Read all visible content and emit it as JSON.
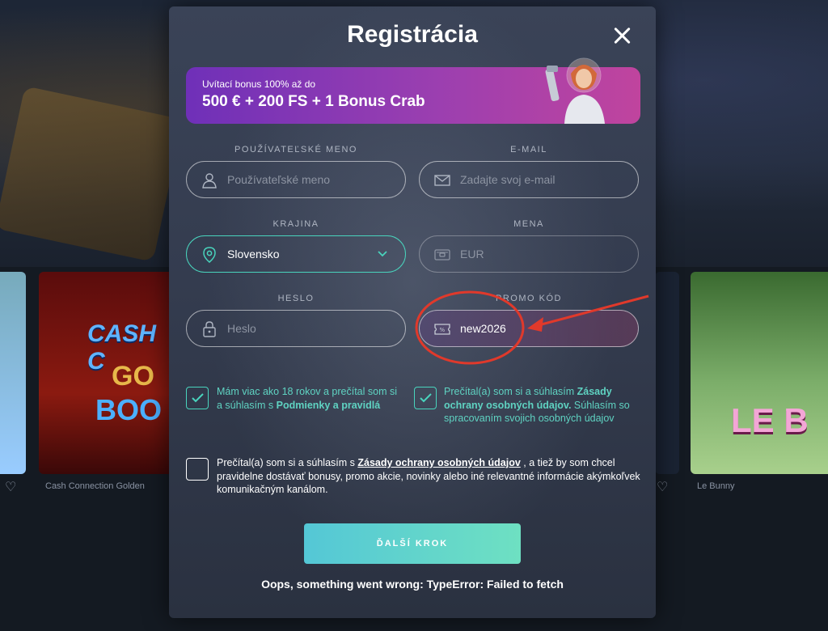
{
  "modal": {
    "title": "Registrácia",
    "promo": {
      "subtitle": "Uvítací bonus 100% až do",
      "headline": "500 € + 200 FS + 1 Bonus Crab"
    },
    "fields": {
      "username": {
        "label": "POUŽÍVATEĽSKÉ MENO",
        "placeholder": "Používateľské meno"
      },
      "email": {
        "label": "E-MAIL",
        "placeholder": "Zadajte svoj e-mail"
      },
      "country": {
        "label": "KRAJINA",
        "value": "Slovensko"
      },
      "currency": {
        "label": "MENA",
        "value": "EUR"
      },
      "password": {
        "label": "HESLO",
        "placeholder": "Heslo"
      },
      "promo_code": {
        "label": "PROMO KÓD",
        "value": "new2026"
      }
    },
    "checkboxes": {
      "age": {
        "checked": true,
        "text_before": "Mám viac ako 18 rokov a prečítal som si a súhlasím s ",
        "link": "Podmienky a pravidlá"
      },
      "privacy": {
        "checked": true,
        "text_before": "Prečítal(a) som si a súhlasím ",
        "link": "Zásady ochrany osobných údajov.",
        "text_after": " Súhlasím so spracovaním svojich osobných údajov"
      },
      "marketing": {
        "checked": false,
        "text_before": "Prečítal(a) som si a súhlasím s ",
        "link": "Zásady ochrany osobných údajov",
        "text_after": " , a tiež by som chcel pravidelne dostávať bonusy, promo akcie, novinky alebo iné relevantné informácie akýmkoľvek komunikačným kanálom."
      }
    },
    "next_button": "ĎALŠÍ KROK",
    "error": "Oops, something went wrong: TypeError: Failed to fetch"
  },
  "background": {
    "games": [
      {
        "name": "Cash Connection Golden",
        "art_text": [
          "CASH C",
          "GO",
          "BOO"
        ]
      },
      {
        "name": "Le Bunny",
        "art_text": [
          "LE B"
        ]
      }
    ]
  },
  "colors": {
    "accent_teal": "#49d4bd",
    "annotation_red": "#e0392b",
    "promo_gradient_start": "#6f30b8",
    "promo_gradient_end": "#c0449e"
  },
  "icons": [
    "user-icon",
    "email-icon",
    "location-pin-icon",
    "chevron-down-icon",
    "currency-icon",
    "lock-icon",
    "promo-ticket-icon",
    "checkmark-icon",
    "close-icon",
    "heart-plus-icon"
  ]
}
